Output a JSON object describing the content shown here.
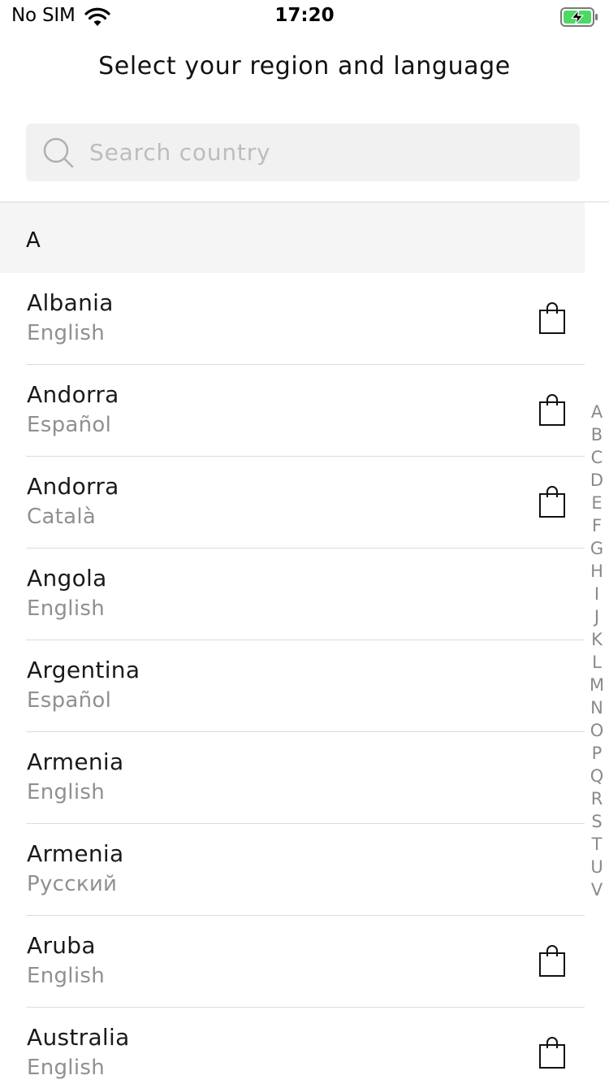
{
  "status_bar": {
    "carrier": "No SIM",
    "time": "17:20",
    "battery_color": "#4cd964"
  },
  "header": {
    "title": "Select your region and language"
  },
  "search": {
    "placeholder": "Search country",
    "value": ""
  },
  "sections": [
    {
      "letter": "A",
      "rows": [
        {
          "country": "Albania",
          "language": "English",
          "shop": true
        },
        {
          "country": "Andorra",
          "language": "Español",
          "shop": true
        },
        {
          "country": "Andorra",
          "language": "Català",
          "shop": true
        },
        {
          "country": "Angola",
          "language": "English",
          "shop": false
        },
        {
          "country": "Argentina",
          "language": "Español",
          "shop": false
        },
        {
          "country": "Armenia",
          "language": "English",
          "shop": false
        },
        {
          "country": "Armenia",
          "language": "Русский",
          "shop": false
        },
        {
          "country": "Aruba",
          "language": "English",
          "shop": true
        },
        {
          "country": "Australia",
          "language": "English",
          "shop": true
        }
      ]
    }
  ],
  "index_letters": [
    "A",
    "B",
    "C",
    "D",
    "E",
    "F",
    "G",
    "H",
    "I",
    "J",
    "K",
    "L",
    "M",
    "N",
    "O",
    "P",
    "Q",
    "R",
    "S",
    "T",
    "U",
    "V"
  ]
}
